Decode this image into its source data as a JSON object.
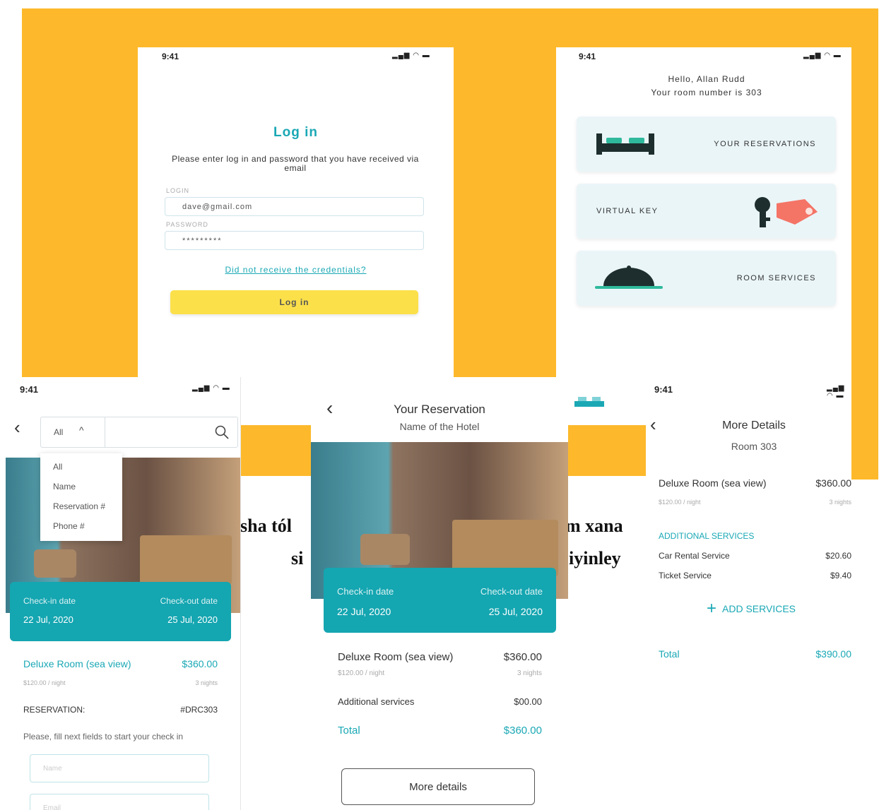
{
  "colors": {
    "background_yellow": "#fdb92b",
    "teal": "#14a6b1",
    "button_yellow": "#fbe04a"
  },
  "status_time": "9:41",
  "login": {
    "title": "Log in",
    "instruction": "Please enter log in and password that you have received via email",
    "login_label": "LOGIN",
    "login_value": "dave@gmail.com",
    "password_label": "PASSWORD",
    "password_value": "*********",
    "forgot_link": "Did not receive the credentials?",
    "button": "Log in"
  },
  "home": {
    "greeting": "Hello, Allan Rudd",
    "room_line": "Your room number is 303",
    "cards": [
      {
        "label": "YOUR RESERVATIONS",
        "icon": "bed-icon"
      },
      {
        "label": "VIRTUAL KEY",
        "icon": "key-icon"
      },
      {
        "label": "ROOM SERVICES",
        "icon": "cloche-icon"
      }
    ]
  },
  "search": {
    "filter_selected": "All",
    "dropdown_options": [
      "All",
      "Name",
      "Reservation #",
      "Phone #"
    ],
    "checkin_label": "Check-in date",
    "checkin_value": "22 Jul, 2020",
    "checkout_label": "Check-out date",
    "checkout_value": "25 Jul, 2020",
    "room_name": "Deluxe Room (sea view)",
    "room_price": "$360.00",
    "rate": "$120.00 / night",
    "nights": "3 nights",
    "reservation_label": "RESERVATION:",
    "reservation_value": "#DRC303",
    "hint": "Please, fill next fields to start your check in",
    "name_placeholder": "Name",
    "email_placeholder": "Email"
  },
  "reservation": {
    "title": "Your Reservation",
    "subtitle": "Name of the Hotel",
    "checkin_label": "Check-in date",
    "checkin_value": "22 Jul, 2020",
    "checkout_label": "Check-out date",
    "checkout_value": "25 Jul, 2020",
    "room_name": "Deluxe Room (sea view)",
    "room_price": "$360.00",
    "rate": "$120.00 / night",
    "nights": "3 nights",
    "additional_label": "Additional services",
    "additional_value": "$00.00",
    "total_label": "Total",
    "total_value": "$360.00",
    "more_button": "More details"
  },
  "details": {
    "title": "More Details",
    "subtitle": "Room 303",
    "room_name": "Deluxe Room (sea view)",
    "room_price": "$360.00",
    "rate": "$120.00 / night",
    "nights": "3 nights",
    "services_header": "ADDITIONAL SERVICES",
    "services": [
      {
        "name": "Car Rental Service",
        "price": "$20.60"
      },
      {
        "name": "Ticket Service",
        "price": "$9.40"
      }
    ],
    "add_button": "ADD SERVICES",
    "total_label": "Total",
    "total_value": "$390.00"
  },
  "caption": {
    "left": "sha tól",
    "right": "m xana",
    "left2": "si",
    "right2": "iyinley"
  }
}
